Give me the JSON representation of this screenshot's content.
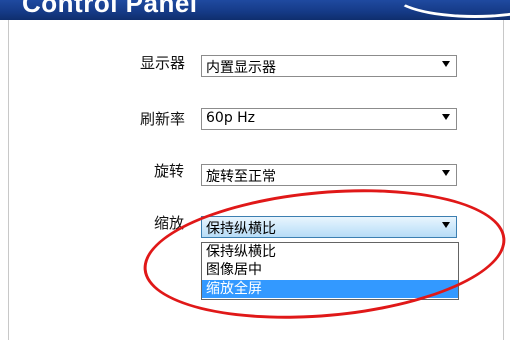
{
  "window": {
    "title": "Control Panel"
  },
  "settings": [
    {
      "label": "显示器",
      "value": "内置显示器"
    },
    {
      "label": "刷新率",
      "value": "60p Hz"
    },
    {
      "label": "旋转",
      "value": "旋转至正常"
    },
    {
      "label": "缩放",
      "value": "保持纵横比"
    }
  ],
  "scaling_options": [
    "保持纵横比",
    "图像居中",
    "缩放全屏"
  ],
  "colors": {
    "titlebar": "#153a86",
    "selection": "#3399ff",
    "annotation": "#e01818"
  }
}
